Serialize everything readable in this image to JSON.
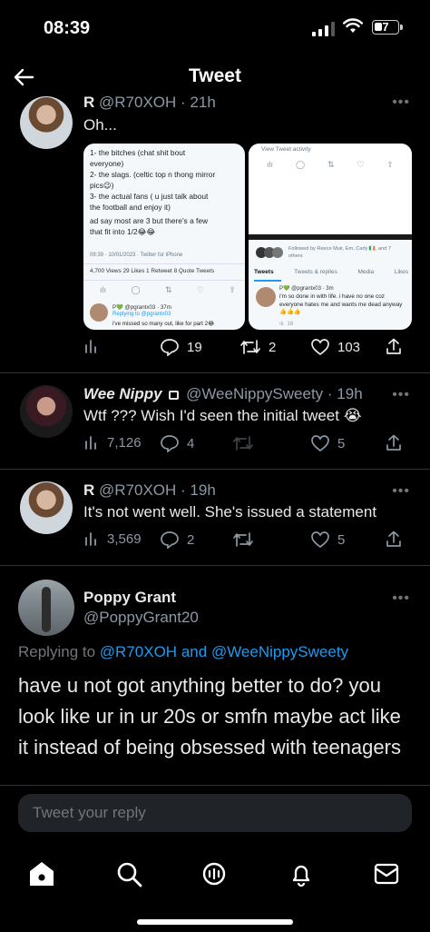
{
  "status": {
    "time": "08:39",
    "battery": "7"
  },
  "header": {
    "title": "Tweet"
  },
  "tweet1": {
    "name": "R",
    "handle": "@R70XOH · 21h",
    "text": "Oh...",
    "image1": {
      "lines": [
        "1- the bitches (chat shit bout",
        "everyone)",
        "2- the slags. (celtic top n thong mirror",
        "pics😉)",
        "3- the actual fans ( u just talk about",
        "the football and enjoy it)",
        "ad say most are 3 but there's a few",
        "that fit into 1/2😂😂"
      ],
      "meta": "09:39 · 10/01/2023 · Twitter for iPhone",
      "stats": "4,700 Views  29 Likes  1 Retweet  8 Quote Tweets",
      "reply_user": "P💚 @pgrantx03 · 37m",
      "reply_to": "Replying to @pgrantx03",
      "reply_text": "i've missed so many out, like for part 2😂"
    },
    "image2": {
      "view_activity": "View Tweet activity",
      "followed_by": "Followed by Reece Muir, Em, Carly 🇮🇪, and 7 others",
      "tabs": [
        "Tweets",
        "Tweets & replies",
        "Media",
        "Likes"
      ],
      "user": "P💚 @pgrantx03 · 3m",
      "text": "i'm so done in with life. i have no one coz everyone hates me and wants me dead anyway 👍👍👍",
      "count": "16"
    },
    "replies": "19",
    "retweets": "2",
    "likes": "103"
  },
  "tweet2": {
    "name": "Wee Nippy",
    "handle": "@WeeNippySweety · 19h",
    "text": "Wtf ??? Wish I'd seen the initial tweet 😭",
    "views": "7,126",
    "replies": "4",
    "likes": "5"
  },
  "tweet3": {
    "name": "R",
    "handle": "@R70XOH · 19h",
    "text": "It's not went well. She's issued a statement",
    "views": "3,569",
    "replies": "2",
    "likes": "5"
  },
  "main": {
    "name": "Poppy Grant",
    "handle": "@PoppyGrant20",
    "replying_label": "Replying to",
    "replying_to_1": "@R70XOH",
    "and": "and",
    "replying_to_2": "@WeeNippySweety",
    "text": "have u not got anything better to do? you look like ur in ur 20s or smfn maybe act like it instead of being obsessed with teenagers"
  },
  "reply": {
    "placeholder": "Tweet your reply"
  },
  "colors": {
    "link": "#1d9bf0",
    "background": "#000000",
    "muted": "#71767b"
  }
}
